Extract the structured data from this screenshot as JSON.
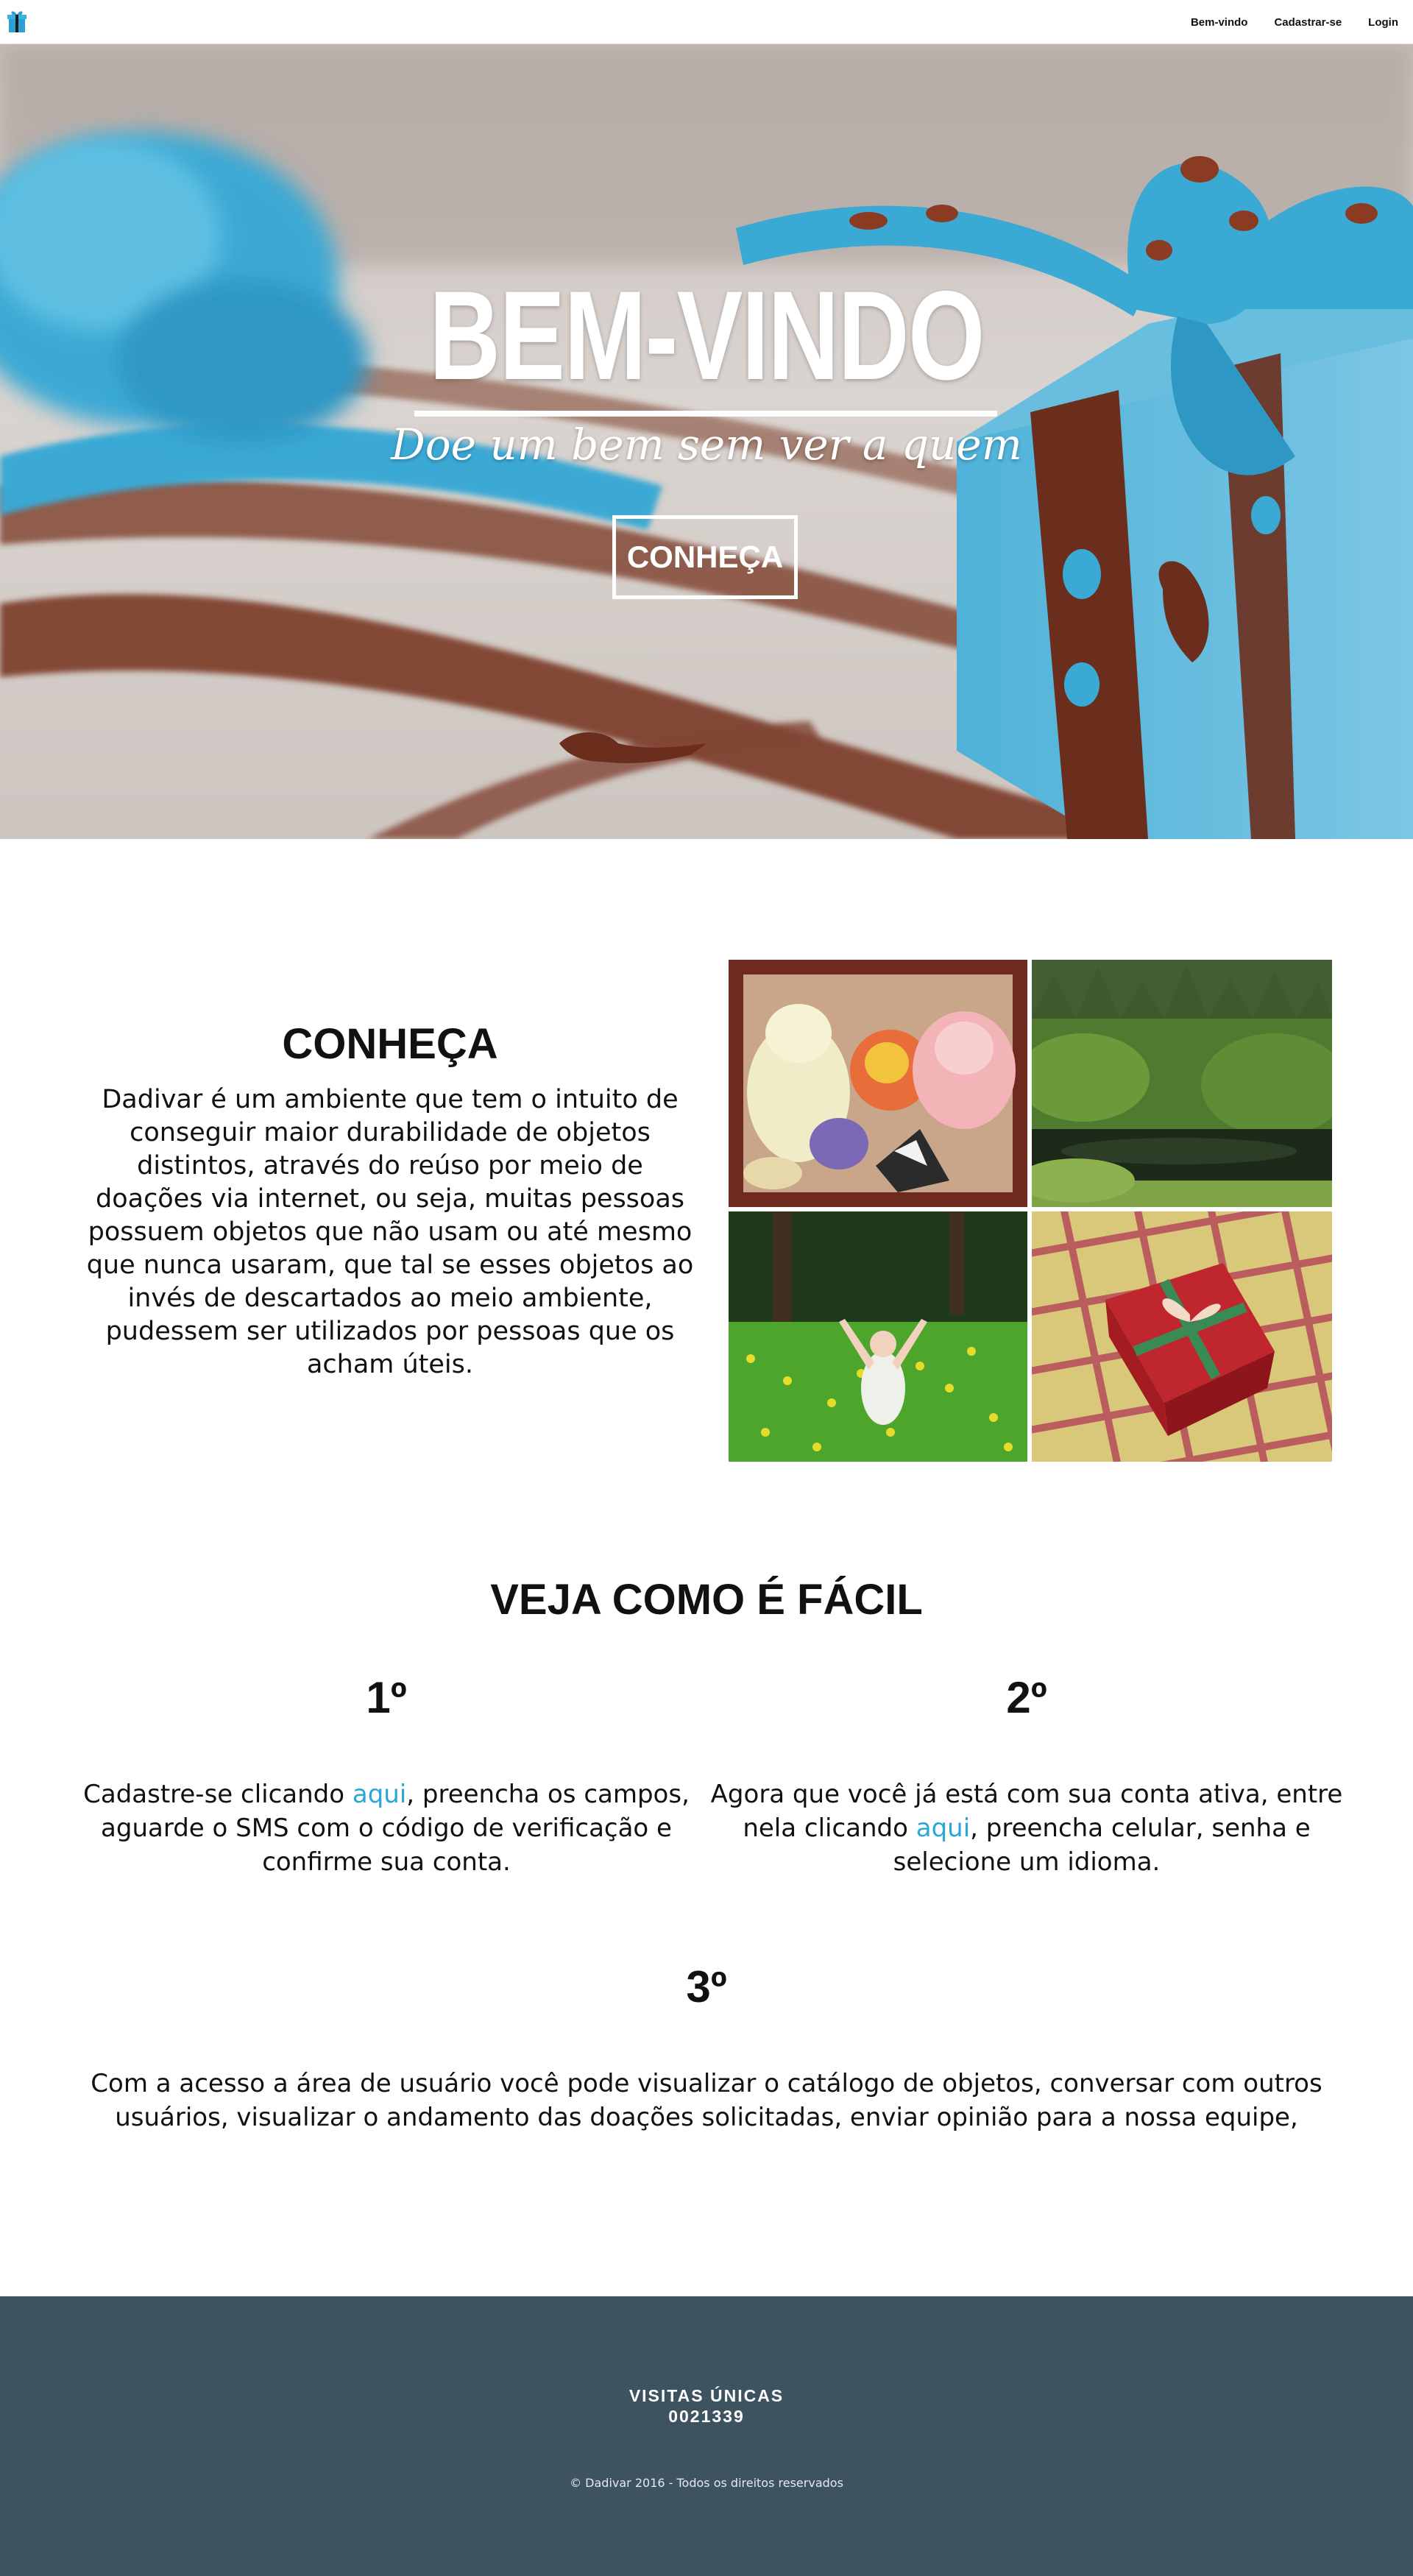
{
  "nav": {
    "logo_icon": "gift-icon",
    "links": [
      "Bem-vindo",
      "Cadastrar-se",
      "Login"
    ]
  },
  "hero": {
    "title": "BEM-VINDO",
    "subtitle": "Doe um bem sem ver a quem",
    "button_label": "CONHEÇA"
  },
  "about": {
    "title": "CONHEÇA",
    "text": "Dadivar é um ambiente que tem o intuito de conseguir maior durabilidade de objetos distintos, através do reúso por meio de doações via internet, ou seja, muitas pessoas possuem objetos que não usam ou até mesmo que nunca usaram, que tal se esses objetos ao invés de descartados ao meio ambiente, pudessem ser utilizados por pessoas que os acham úteis."
  },
  "steps": {
    "title": "VEJA COMO É FÁCIL",
    "step1": {
      "number": "1º",
      "before": "Cadastre-se clicando ",
      "link": "aqui",
      "after": ", preencha os campos, aguarde o SMS com o código de verificação e confirme sua conta."
    },
    "step2": {
      "number": "2º",
      "before": "Agora que você já está com sua conta ativa, entre nela clicando ",
      "link": "aqui",
      "after": ", preencha celular, senha e selecione um idioma."
    },
    "step3": {
      "number": "3º",
      "text": "Com a acesso a área de usuário você pode visualizar o catálogo de objetos, conversar com outros usuários, visualizar o andamento das doações solicitadas, enviar opinião para a nossa equipe,"
    }
  },
  "footer": {
    "visits_label": "VISITAS ÚNICAS",
    "visits_count": "0021339",
    "copyright": "© Dadivar 2016 - Todos os direitos reservados"
  },
  "colors": {
    "link": "#29a7d6",
    "footer_bg": "#3e5360",
    "ribbon_blue": "#3aaed8",
    "ribbon_brown": "#6b2e1c"
  }
}
